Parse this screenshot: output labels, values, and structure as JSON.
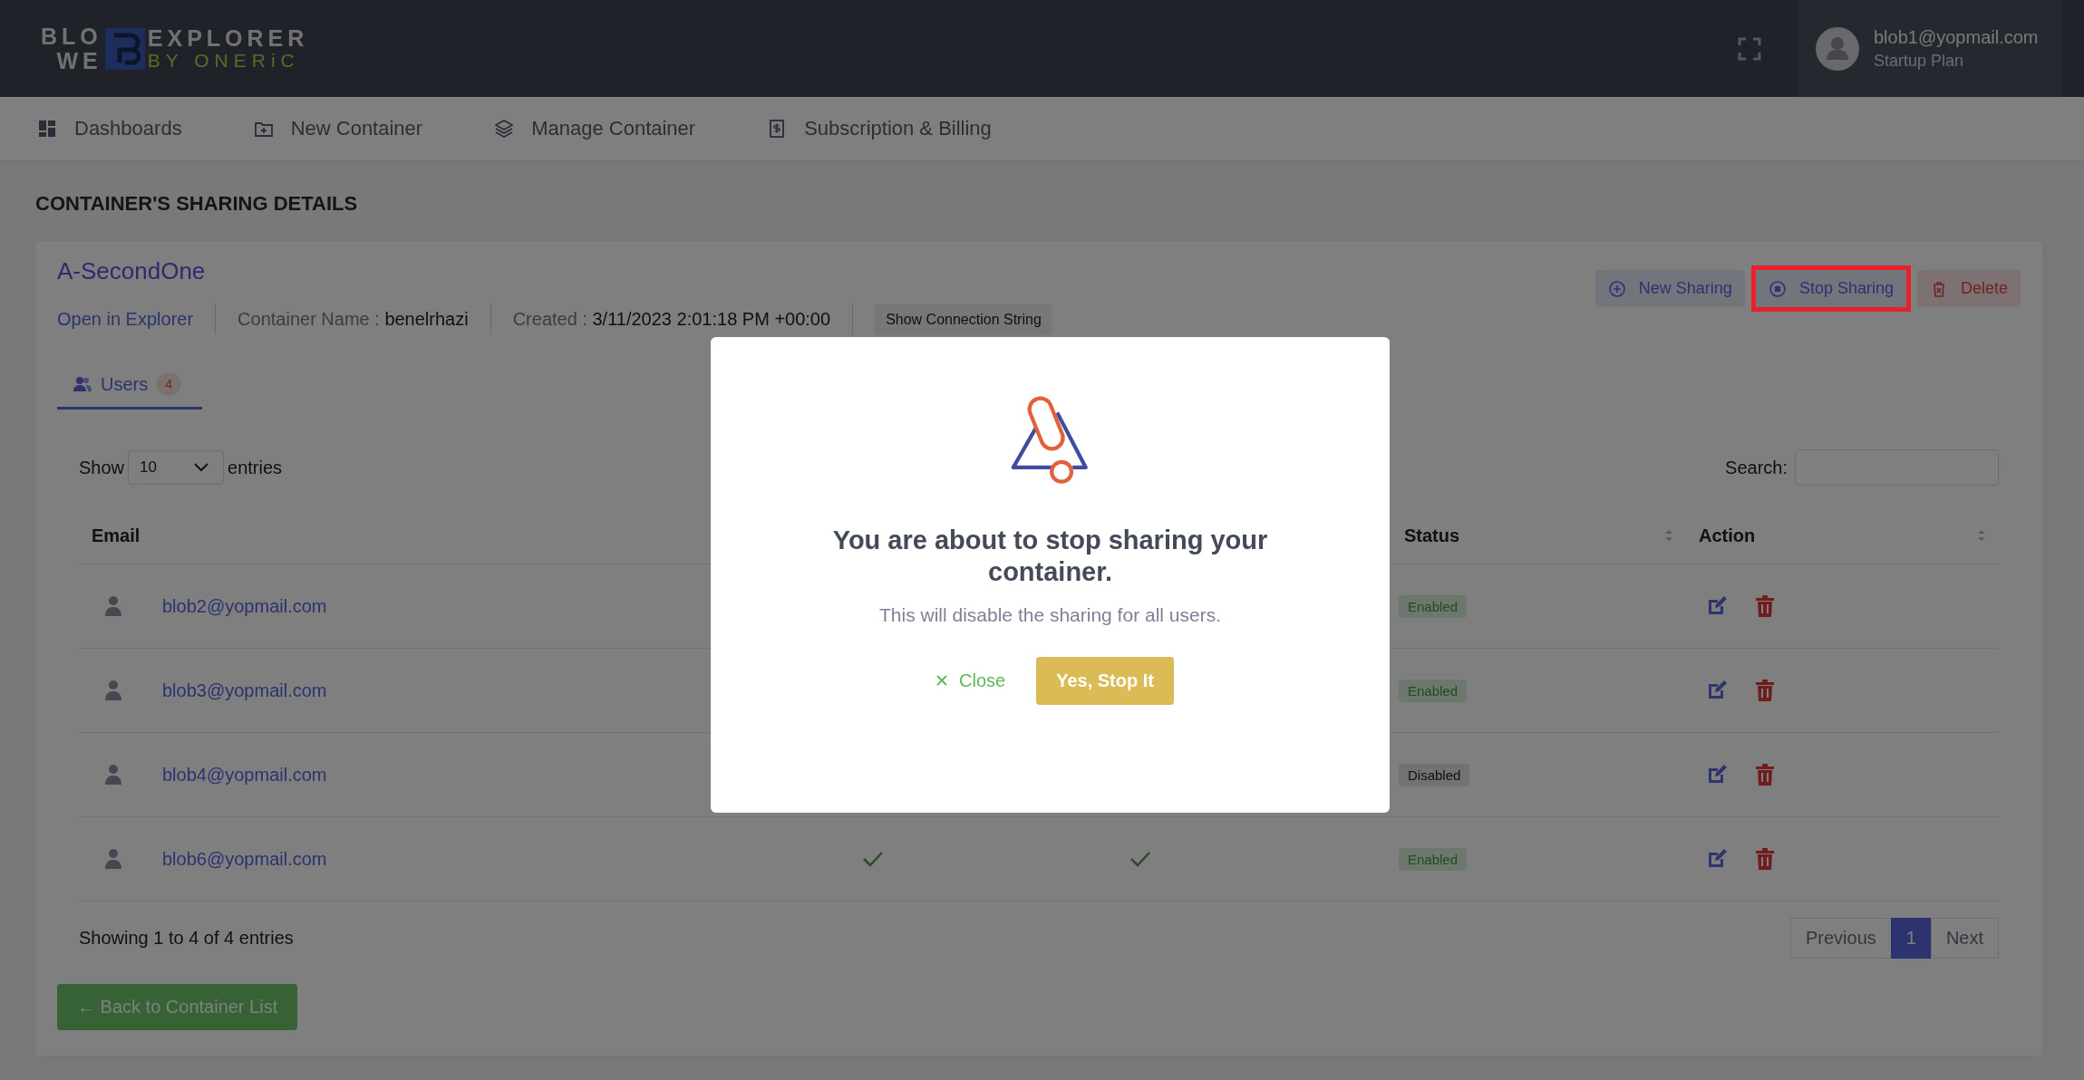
{
  "header": {
    "logo": {
      "line_1": "BLO",
      "line_2": "WE",
      "word": "EXPLORER",
      "tagline": "BY ONERiC"
    },
    "user": {
      "email": "blob1@yopmail.com",
      "plan": "Startup Plan"
    }
  },
  "nav": [
    {
      "label": "Dashboards"
    },
    {
      "label": "New Container"
    },
    {
      "label": "Manage Container"
    },
    {
      "label": "Subscription & Billing"
    }
  ],
  "page_title": "CONTAINER'S SHARING DETAILS",
  "container": {
    "name": "A-SecondOne",
    "open_link": "Open in Explorer",
    "meta": [
      {
        "label": "Container Name :",
        "value": "benelrhazi"
      },
      {
        "label": "Created :",
        "value": "3/11/2023 2:01:18 PM +00:00"
      }
    ],
    "connection_button": "Show Connection String",
    "actions": [
      {
        "label": "New Sharing",
        "kind": "new",
        "highlighted": false
      },
      {
        "label": "Stop Sharing",
        "kind": "stop",
        "highlighted": true
      },
      {
        "label": "Delete",
        "kind": "delete",
        "highlighted": false
      }
    ]
  },
  "tabs": [
    {
      "label": "Users",
      "count": "4",
      "selected": true
    }
  ],
  "length_menu": {
    "before": "Show",
    "value": "10",
    "after": "entries"
  },
  "search": {
    "label": "Search:"
  },
  "table": {
    "columns": [
      {
        "label": "Email"
      },
      {
        "label": "Status",
        "sortable": true
      },
      {
        "label": "Action",
        "sortable": true
      }
    ],
    "rows": [
      {
        "email": "blob2@yopmail.com",
        "status": "Enabled",
        "enabled": true
      },
      {
        "email": "blob3@yopmail.com",
        "status": "Enabled",
        "enabled": true
      },
      {
        "email": "blob4@yopmail.com",
        "status": "Disabled",
        "enabled": false
      },
      {
        "email": "blob6@yopmail.com",
        "column_2_checked": true,
        "column_3_checked": true,
        "status": "Enabled",
        "enabled": true
      }
    ]
  },
  "info": "Showing 1 to 4 of 4 entries",
  "pagination": [
    {
      "label": "Previous",
      "selected": false
    },
    {
      "label": "1",
      "selected": true
    },
    {
      "label": "Next",
      "selected": false
    }
  ],
  "back_button": "← Back to Container List",
  "modal": {
    "title": "You are about to stop sharing your container.",
    "message": "This will disable the sharing for all users.",
    "close_button": "Close",
    "confirm_button": "Yes, Stop It"
  }
}
